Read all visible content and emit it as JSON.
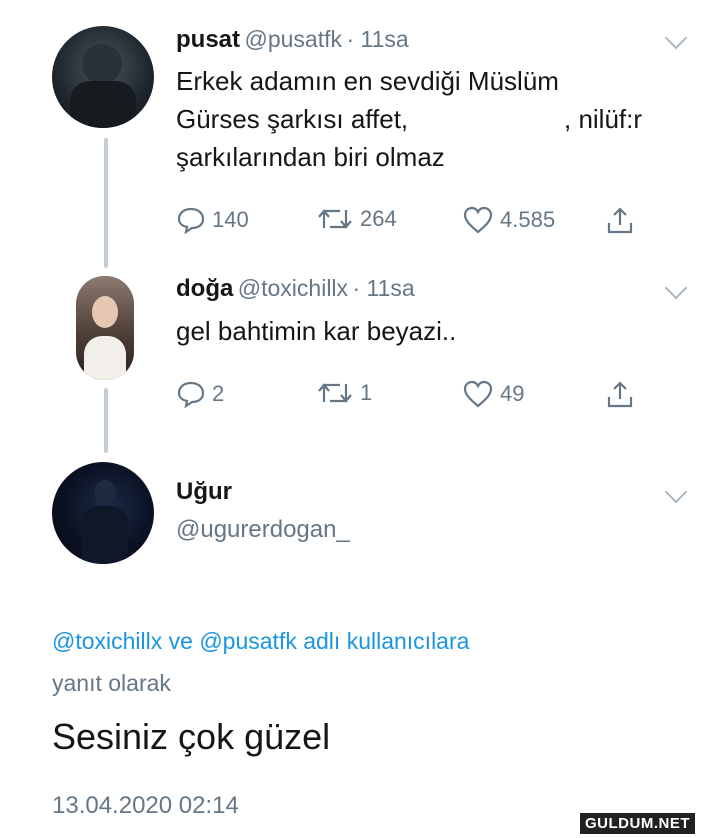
{
  "tweets": [
    {
      "name": "pusat",
      "handle": "@pusatfk",
      "time": "· 11sa",
      "lines": [
        "Erkek adamın en sevdiği Müslüm",
        "Gürses şarkısı affet,",
        ", nilüf:r",
        "şarkılarından biri olmaz"
      ],
      "actions": {
        "replies": "140",
        "retweets": "264",
        "likes": "4.585"
      }
    },
    {
      "name": "doğa",
      "handle": "@toxichillx",
      "time": "· 11sa",
      "lines": [
        "gel bahtimin kar beyazi.."
      ],
      "actions": {
        "replies": "2",
        "retweets": "1",
        "likes": "49"
      }
    }
  ],
  "main_tweet": {
    "name": "Uğur",
    "handle": "@ugurerdogan_",
    "reply_to": {
      "mentions": "@toxichillx ve @pusatfk adlı kullanıcılara",
      "suffix": "yanıt olarak"
    },
    "text": "Sesiniz çok güzel",
    "timestamp": "13.04.2020 02:14"
  },
  "icons": [
    "reply-icon",
    "retweet-icon",
    "like-icon",
    "share-icon",
    "chevron-down-icon"
  ],
  "colors": {
    "link": "#1b95e0",
    "muted": "#657786",
    "line": "#c4cdd3"
  },
  "watermark": "GULDUM.NET"
}
